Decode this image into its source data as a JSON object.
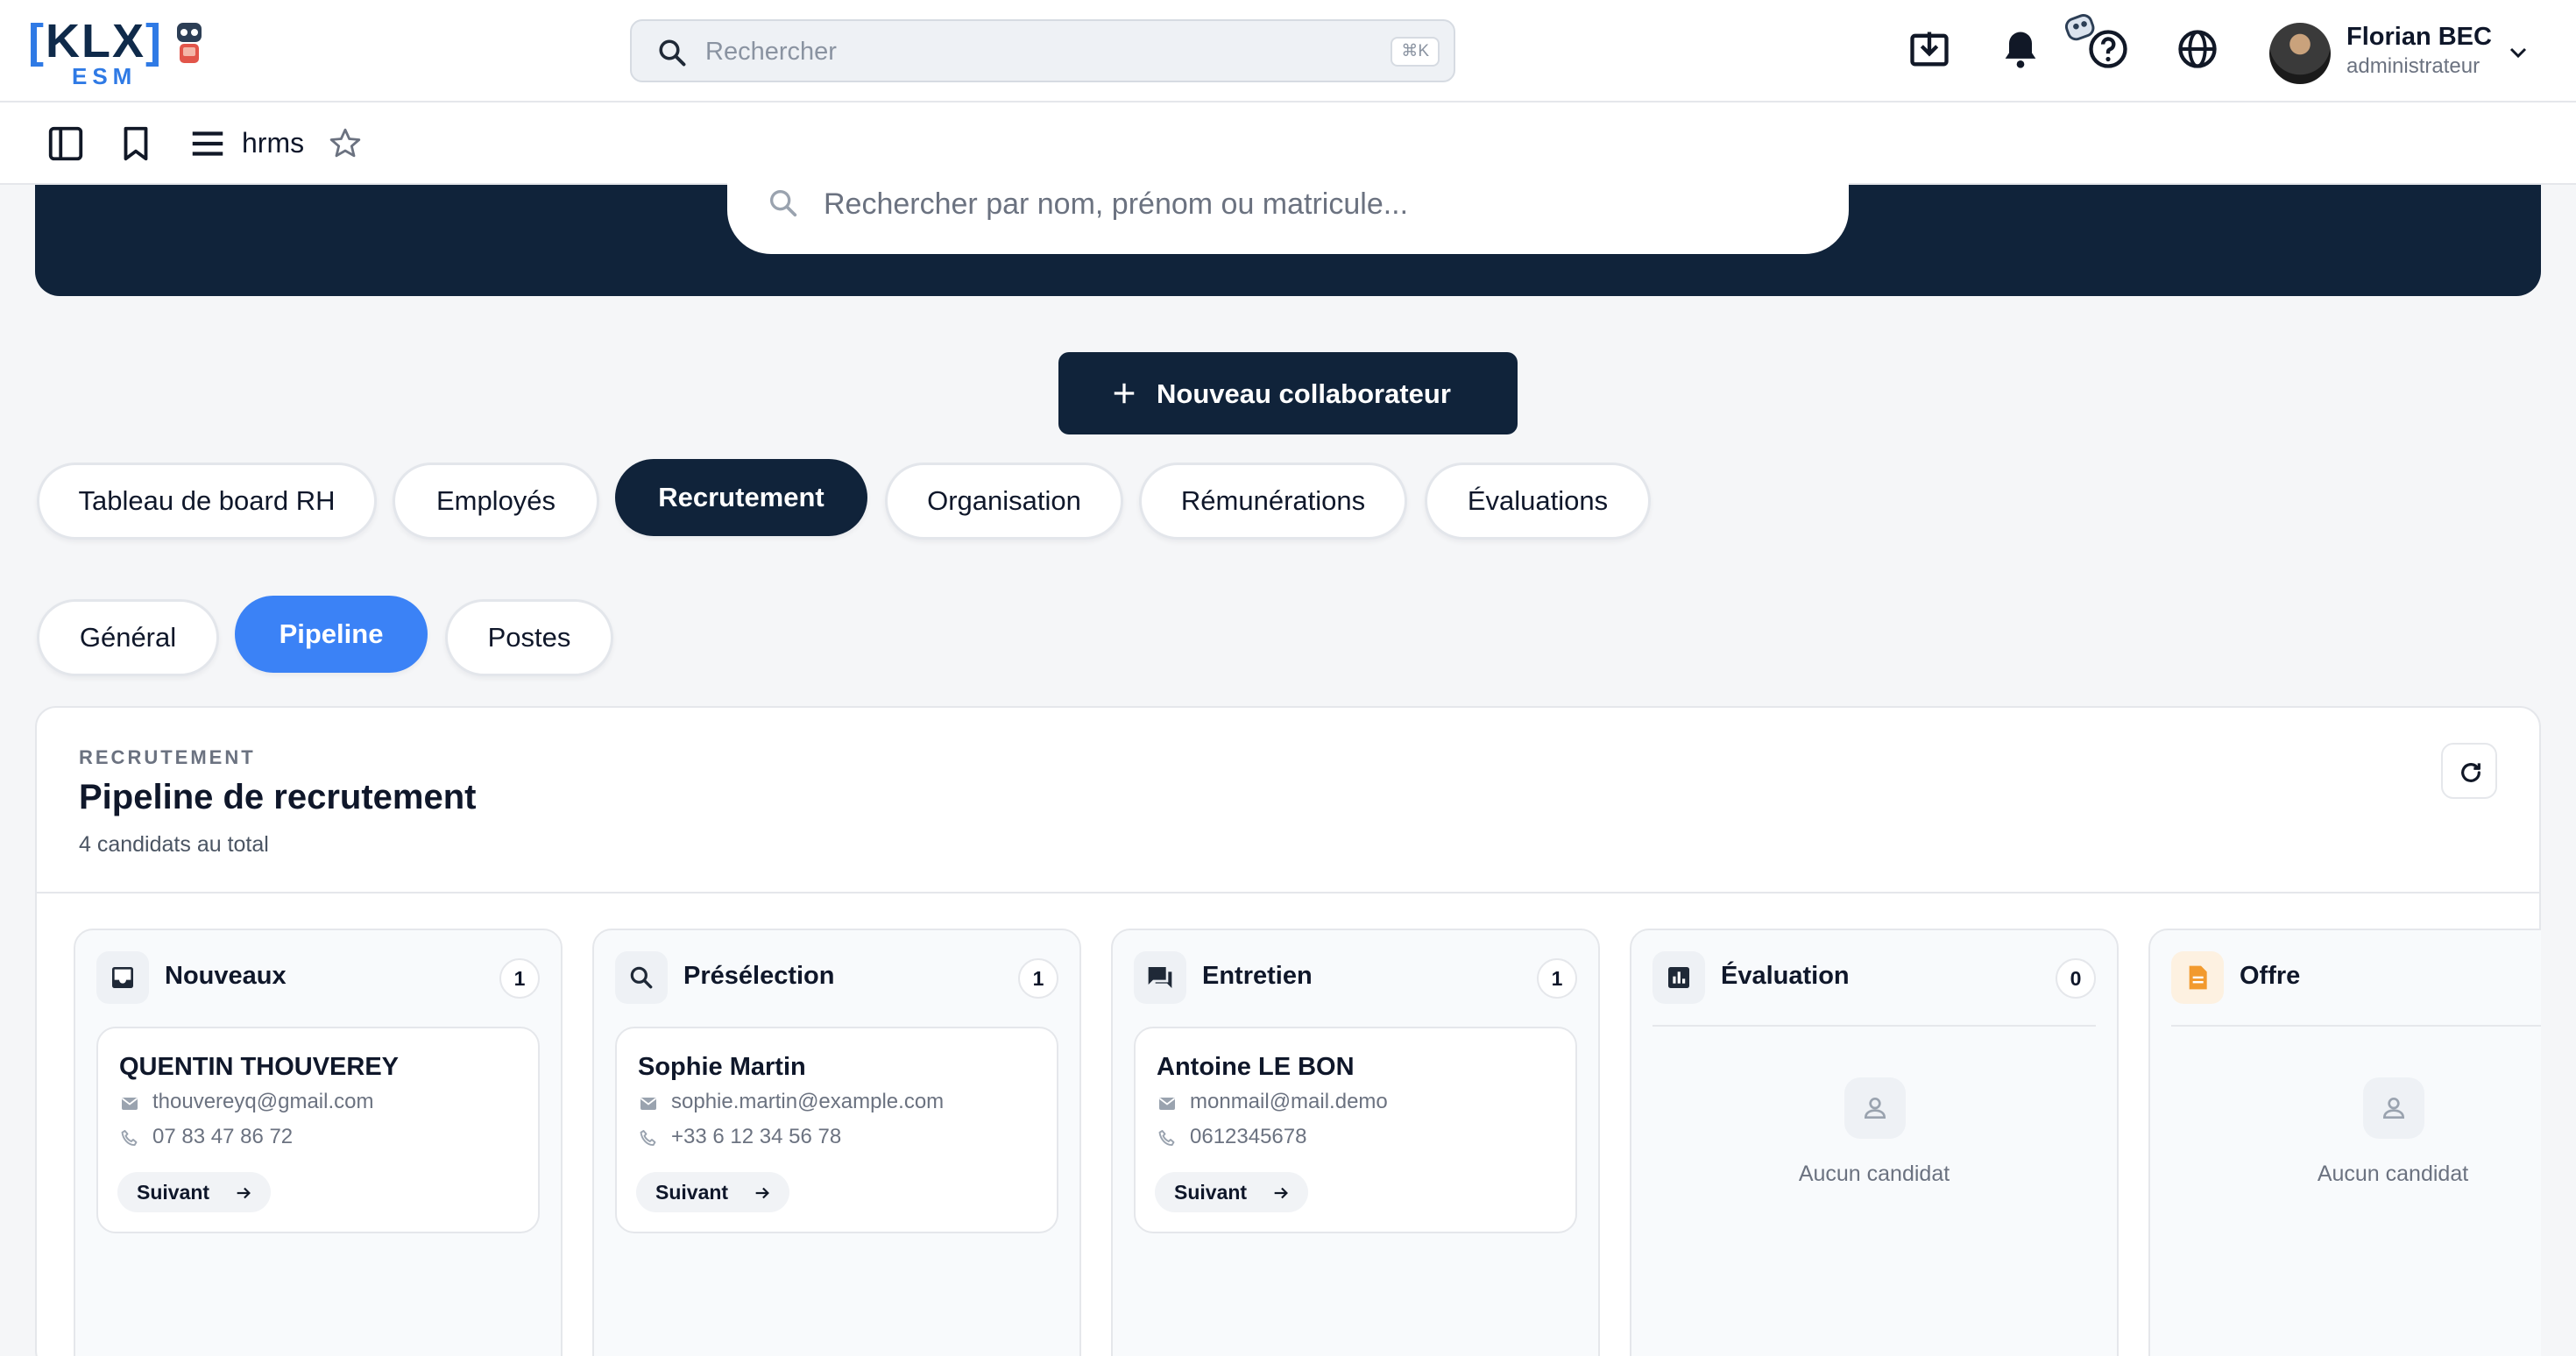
{
  "colors": {
    "navy": "#10233a",
    "accent_blue": "#3b82f6",
    "logo_blue": "#2f7ae5"
  },
  "header": {
    "logo_main": "KLX",
    "logo_sub": "ESM",
    "search_placeholder": "Rechercher",
    "search_shortcut": "⌘K",
    "icons": [
      "download-icon",
      "bell-icon",
      "assistant-bot-icon",
      "help-icon",
      "globe-icon"
    ],
    "user": {
      "name": "Florian BEC",
      "role": "administrateur"
    }
  },
  "toolbar": {
    "app_name": "hrms",
    "icons": [
      "sidebar-toggle-icon",
      "bookmark-icon",
      "menu-icon",
      "star-icon"
    ]
  },
  "hero": {
    "search_placeholder": "Rechercher par nom, prénom ou matricule..."
  },
  "new_collaborator_label": "Nouveau collaborateur",
  "main_tabs": [
    {
      "label": "Tableau de board RH",
      "active": false
    },
    {
      "label": "Employés",
      "active": false
    },
    {
      "label": "Recrutement",
      "active": true
    },
    {
      "label": "Organisation",
      "active": false
    },
    {
      "label": "Rémunérations",
      "active": false
    },
    {
      "label": "Évaluations",
      "active": false
    }
  ],
  "sub_tabs": [
    {
      "label": "Général",
      "active": false
    },
    {
      "label": "Pipeline",
      "active": true
    },
    {
      "label": "Postes",
      "active": false
    }
  ],
  "pipeline": {
    "eyebrow": "RECRUTEMENT",
    "title": "Pipeline de recrutement",
    "subtitle": "4 candidats au total",
    "next_label": "Suivant",
    "empty_label": "Aucun candidat",
    "columns": [
      {
        "title": "Nouveaux",
        "count": "1",
        "icon": "inbox-icon",
        "candidates": [
          {
            "name": "QUENTIN THOUVEREY",
            "email": "thouvereyq@gmail.com",
            "phone": "07 83 47 86 72"
          }
        ]
      },
      {
        "title": "Présélection",
        "count": "1",
        "icon": "search-icon",
        "candidates": [
          {
            "name": "Sophie Martin",
            "email": "sophie.martin@example.com",
            "phone": "+33 6 12 34 56 78"
          }
        ]
      },
      {
        "title": "Entretien",
        "count": "1",
        "icon": "chat-icon",
        "candidates": [
          {
            "name": "Antoine LE BON",
            "email": "monmail@mail.demo",
            "phone": "0612345678"
          }
        ]
      },
      {
        "title": "Évaluation",
        "count": "0",
        "icon": "chart-icon",
        "candidates": []
      },
      {
        "title": "Offre",
        "count": "",
        "icon": "document-icon",
        "candidates": []
      }
    ]
  }
}
